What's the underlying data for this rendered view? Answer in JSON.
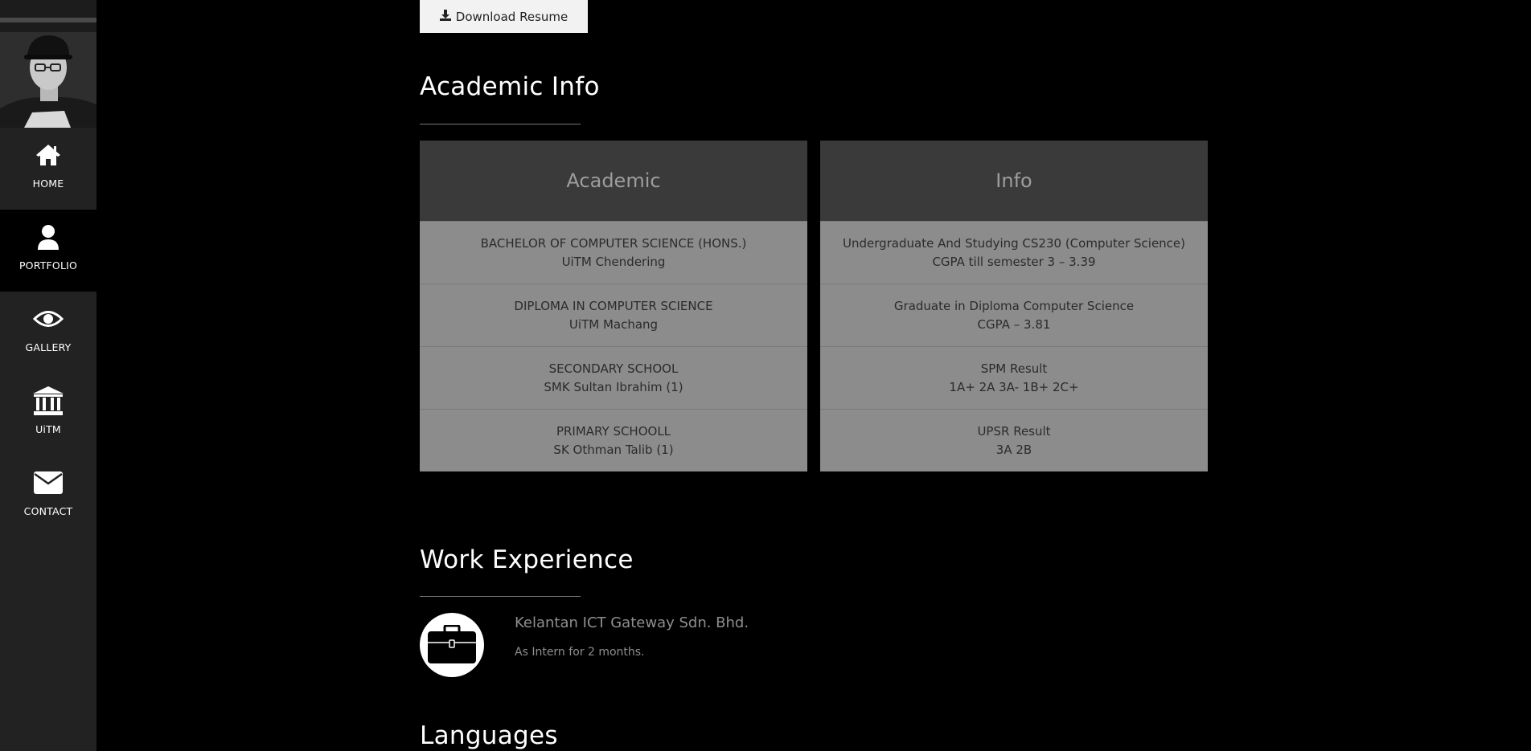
{
  "sidebar": {
    "items": [
      {
        "label": "HOME",
        "icon": "home-icon"
      },
      {
        "label": "PORTFOLIO",
        "icon": "user-icon",
        "active": true
      },
      {
        "label": "GALLERY",
        "icon": "eye-icon"
      },
      {
        "label": "UiTM",
        "icon": "institution-icon"
      },
      {
        "label": "CONTACT",
        "icon": "envelope-icon"
      }
    ]
  },
  "download": {
    "label": "Download Resume",
    "icon": "download-icon"
  },
  "academic": {
    "title": "Academic Info",
    "headers": [
      "Academic",
      "Info"
    ],
    "rows": [
      {
        "academic": [
          "BACHELOR OF COMPUTER SCIENCE (HONS.)",
          "UiTM Chendering"
        ],
        "info": [
          "Undergraduate And Studying CS230 (Computer Science)",
          "CGPA till semester 3 – 3.39"
        ]
      },
      {
        "academic": [
          "DIPLOMA IN COMPUTER SCIENCE",
          "UiTM Machang"
        ],
        "info": [
          "Graduate in Diploma Computer Science",
          "CGPA – 3.81"
        ]
      },
      {
        "academic": [
          "SECONDARY SCHOOL",
          "SMK Sultan Ibrahim (1)"
        ],
        "info": [
          "SPM Result",
          "1A+ 2A 3A- 1B+ 2C+"
        ]
      },
      {
        "academic": [
          "PRIMARY SCHOOLL",
          "SK Othman Talib (1)"
        ],
        "info": [
          "UPSR Result",
          "3A 2B"
        ]
      }
    ]
  },
  "work": {
    "title": "Work Experience",
    "company": "Kelantan ICT Gateway Sdn. Bhd.",
    "role": "As Intern for 2 months.",
    "icon": "briefcase-icon"
  },
  "languages": {
    "title": "Languages"
  },
  "colors": {
    "sidebar_bg": "#222222",
    "active_bg": "#000000",
    "header_bg": "#3a3a3a",
    "cell_bg": "#8c8c8c"
  }
}
